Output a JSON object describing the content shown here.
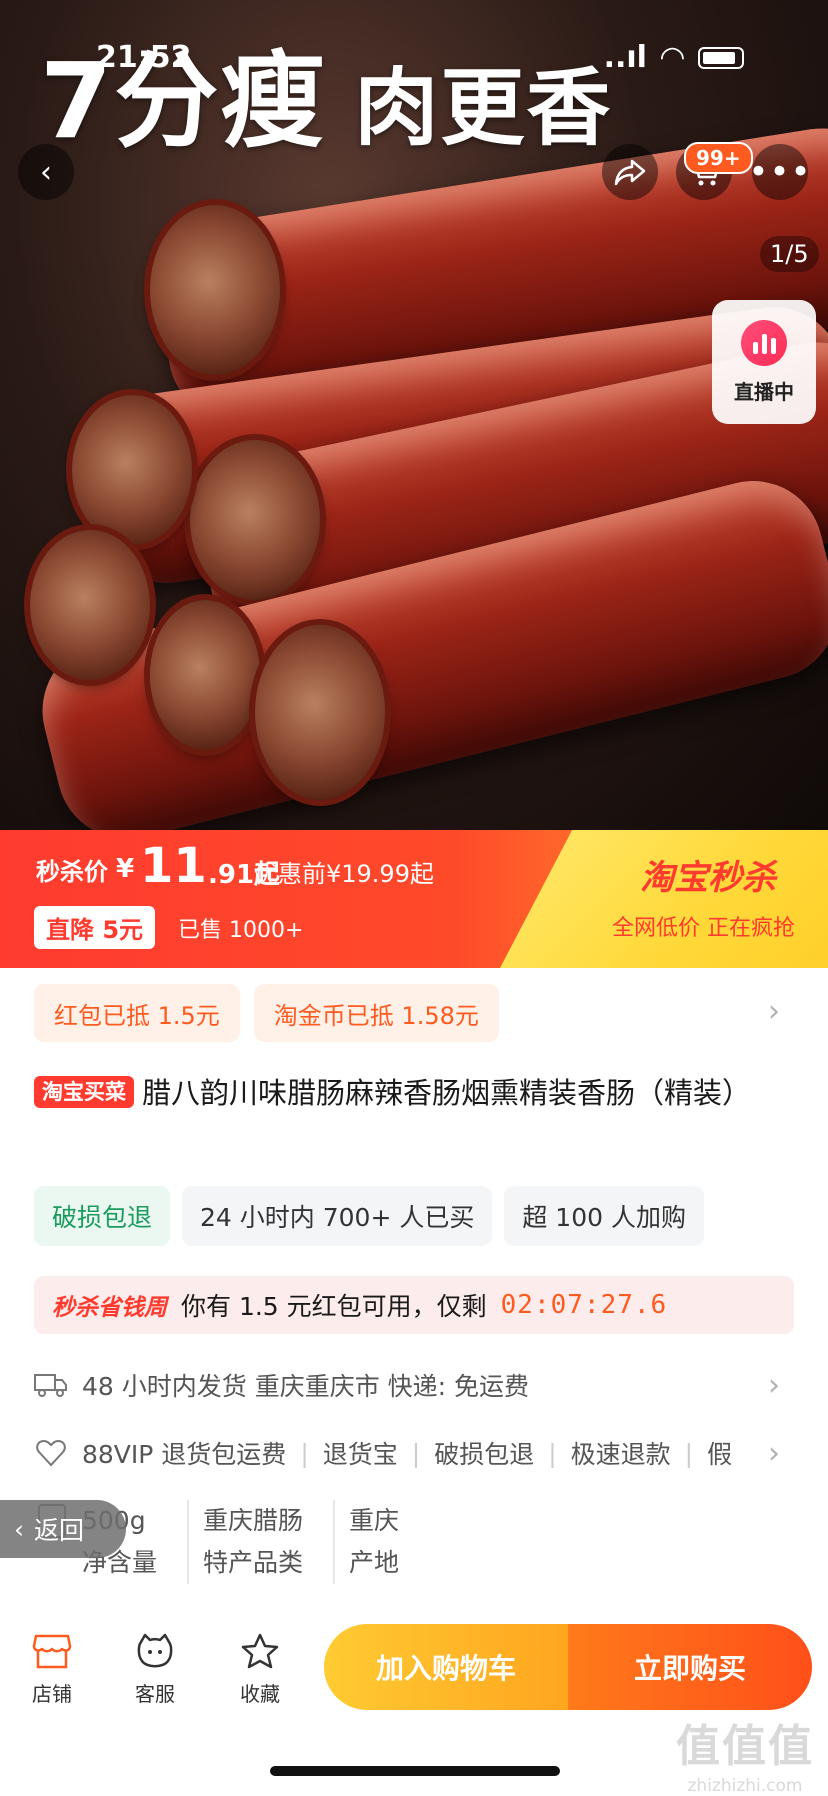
{
  "status_bar": {
    "time": "21:52",
    "signal": "..ıl",
    "wifi": "◠"
  },
  "hero": {
    "headline_big": "7分瘦",
    "headline_small": "肉更香",
    "pager": "1/5",
    "cart_badge": "99+",
    "live_label": "直播中"
  },
  "price_banner": {
    "flash_label": "秒杀价",
    "currency": "¥",
    "price_int": "11",
    "price_dec": ".91起",
    "original_price": "优惠前¥19.99起",
    "drop_badge": "直降 5元",
    "sold": "已售 1000+",
    "campaign_logo": "淘宝秒杀",
    "campaign_sub": "全网低价 正在疯抢"
  },
  "coupons": [
    "红包已抵 1.5元",
    "淘金币已抵 1.58元"
  ],
  "product": {
    "tag": "淘宝买菜",
    "title": "腊八韵川味腊肠麻辣香肠烟熏精装香肠（精装）"
  },
  "tags": [
    "破损包退",
    "24 小时内 700+ 人已买",
    "超 100 人加购"
  ],
  "save_strip": {
    "logo": "秒杀省钱周",
    "text": "你有 1.5 元红包可用，仅剩",
    "countdown": "02:07:27.6"
  },
  "shipping": {
    "text": "48 小时内发货  重庆重庆市  快递:  免运费"
  },
  "services": [
    "88VIP 退货包运费",
    "退货宝",
    "破损包退",
    "极速退款",
    "假"
  ],
  "specs": [
    {
      "value": "500g",
      "key": "净含量"
    },
    {
      "value": "重庆腊肠",
      "key": "特产品类"
    },
    {
      "value": "重庆",
      "key": "产地"
    }
  ],
  "floating_back": "返回",
  "bottom_bar": {
    "shop": "店铺",
    "service": "客服",
    "favorite": "收藏",
    "add_to_cart": "加入购物车",
    "buy_now": "立即购买"
  },
  "watermark": {
    "logo": "值值值",
    "url": "zhizhizhi.com"
  },
  "colors": {
    "accent_red": "#ff3b2f",
    "accent_orange": "#ff5a1f",
    "banner_yellow": "#ffd93a",
    "green_tag": "#1c9b5e"
  }
}
